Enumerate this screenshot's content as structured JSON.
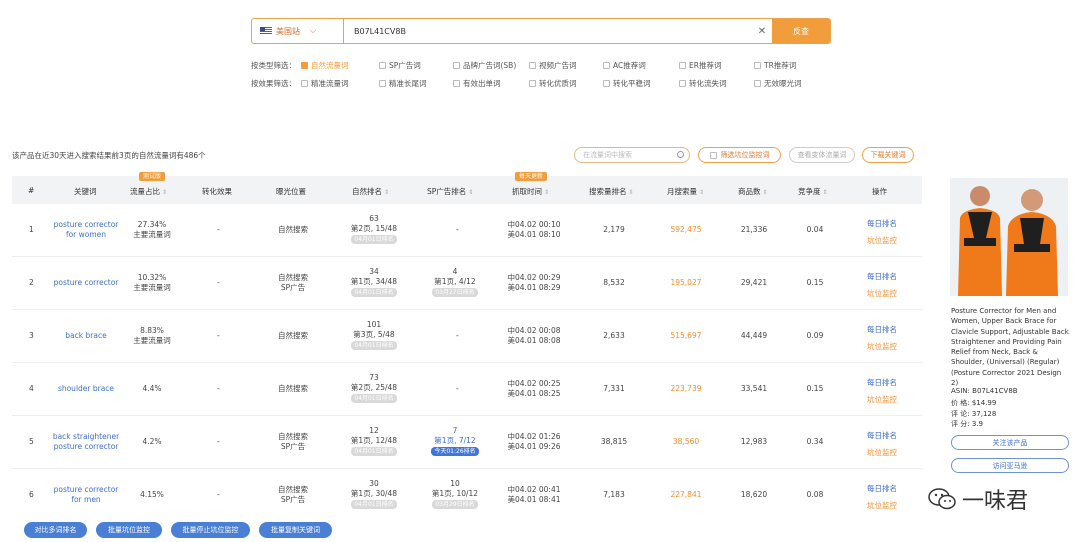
{
  "search": {
    "site": "美国站",
    "query": "B07L41CV8B",
    "button": "反查"
  },
  "filters": {
    "type_label": "按类型筛选：",
    "type_options": [
      {
        "label": "自然流量词",
        "checked": true
      },
      {
        "label": "SP广告词",
        "checked": false
      },
      {
        "label": "品牌广告词(SB)",
        "checked": false
      },
      {
        "label": "视频广告词",
        "checked": false
      },
      {
        "label": "AC推荐词",
        "checked": false
      },
      {
        "label": "ER推荐词",
        "checked": false
      },
      {
        "label": "TR推荐词",
        "checked": false
      }
    ],
    "effect_label": "按效果筛选：",
    "effect_options": [
      {
        "label": "精准流量词",
        "checked": false
      },
      {
        "label": "精准长尾词",
        "checked": false
      },
      {
        "label": "有效出单词",
        "checked": false
      },
      {
        "label": "转化优质词",
        "checked": false
      },
      {
        "label": "转化平稳词",
        "checked": false
      },
      {
        "label": "转化流失词",
        "checked": false
      },
      {
        "label": "无效曝光词",
        "checked": false
      }
    ]
  },
  "summary": "该产品在近30天进入搜索结果前3页的自然流量词有486个",
  "tools": {
    "search_placeholder": "在流量词中搜索",
    "filter_monitor": "筛选坑位监控词",
    "variant_traffic": "查看变体流量词",
    "download": "下载关键词"
  },
  "table": {
    "headers": {
      "index": "#",
      "keyword": "关键词",
      "share": "流量占比",
      "share_tag": "测试版",
      "conversion": "转化效果",
      "exposure": "曝光位置",
      "natural_rank": "自然排名",
      "sp_rank": "SP广告排名",
      "crawl_time": "抓取时间",
      "crawl_tag": "每天更新",
      "search_rank": "搜索量排名",
      "monthly": "月搜索量",
      "products": "商品数",
      "competition": "竞争度",
      "action": "操作"
    },
    "rows": [
      {
        "idx": "1",
        "kw1": "posture corrector",
        "kw2": "for women",
        "share": "27.34%",
        "share_sub": "主要流量词",
        "conv": "-",
        "exp1": "自然搜索",
        "exp2": "",
        "nr_num": "63",
        "nr_page": "第2页, 15/48",
        "nr_date": "04月01日排名",
        "sp_num": "",
        "sp_page": "",
        "sp_date": "",
        "sp_dash": "-",
        "sp_today": false,
        "t_cn": "中04.02 00:10",
        "t_us": "美04.01 08:10",
        "srank": "2,179",
        "monthly": "592,475",
        "products": "21,336",
        "comp": "0.04",
        "a1": "每日排名",
        "a2": "坑位监控"
      },
      {
        "idx": "2",
        "kw1": "posture corrector",
        "kw2": "",
        "share": "10.32%",
        "share_sub": "主要流量词",
        "conv": "-",
        "exp1": "自然搜索",
        "exp2": "SP广告",
        "nr_num": "34",
        "nr_page": "第1页, 34/48",
        "nr_date": "04月01日排名",
        "sp_num": "4",
        "sp_page": "第1页, 4/12",
        "sp_date": "03月27日排名",
        "sp_dash": "",
        "sp_today": false,
        "t_cn": "中04.02 00:29",
        "t_us": "美04.01 08:29",
        "srank": "8,532",
        "monthly": "195,027",
        "products": "29,421",
        "comp": "0.15",
        "a1": "每日排名",
        "a2": "坑位监控"
      },
      {
        "idx": "3",
        "kw1": "back brace",
        "kw2": "",
        "share": "8.83%",
        "share_sub": "主要流量词",
        "conv": "-",
        "exp1": "自然搜索",
        "exp2": "",
        "nr_num": "101",
        "nr_page": "第3页, 5/48",
        "nr_date": "04月01日排名",
        "sp_num": "",
        "sp_page": "",
        "sp_date": "",
        "sp_dash": "-",
        "sp_today": false,
        "t_cn": "中04.02 00:08",
        "t_us": "美04.01 08:08",
        "srank": "2,633",
        "monthly": "515,697",
        "products": "44,449",
        "comp": "0.09",
        "a1": "每日排名",
        "a2": "坑位监控"
      },
      {
        "idx": "4",
        "kw1": "shoulder brace",
        "kw2": "",
        "share": "4.4%",
        "share_sub": "",
        "conv": "-",
        "exp1": "自然搜索",
        "exp2": "",
        "nr_num": "73",
        "nr_page": "第2页, 25/48",
        "nr_date": "04月01日排名",
        "sp_num": "",
        "sp_page": "",
        "sp_date": "",
        "sp_dash": "-",
        "sp_today": false,
        "t_cn": "中04.02 00:25",
        "t_us": "美04.01 08:25",
        "srank": "7,331",
        "monthly": "223,739",
        "products": "33,541",
        "comp": "0.15",
        "a1": "每日排名",
        "a2": "坑位监控"
      },
      {
        "idx": "5",
        "kw1": "back straightener",
        "kw2": "posture corrector",
        "share": "4.2%",
        "share_sub": "",
        "conv": "-",
        "exp1": "自然搜索",
        "exp2": "SP广告",
        "nr_num": "12",
        "nr_page": "第1页, 12/48",
        "nr_date": "04月01日排名",
        "sp_num": "7",
        "sp_page": "第1页, 7/12",
        "sp_date": "今天01:26排名",
        "sp_dash": "",
        "sp_today": true,
        "t_cn": "中04.02 01:26",
        "t_us": "美04.01 09:26",
        "srank": "38,815",
        "monthly": "38,560",
        "products": "12,983",
        "comp": "0.34",
        "a1": "每日排名",
        "a2": "坑位监控"
      },
      {
        "idx": "6",
        "kw1": "posture corrector",
        "kw2": "for men",
        "share": "4.15%",
        "share_sub": "",
        "conv": "-",
        "exp1": "自然搜索",
        "exp2": "SP广告",
        "nr_num": "30",
        "nr_page": "第1页, 30/48",
        "nr_date": "04月01日排名",
        "sp_num": "10",
        "sp_page": "第1页, 10/12",
        "sp_date": "03月29日排名",
        "sp_dash": "",
        "sp_today": false,
        "t_cn": "中04.02 00:41",
        "t_us": "美04.01 08:41",
        "srank": "7,183",
        "monthly": "227,841",
        "products": "18,620",
        "comp": "0.08",
        "a1": "每日排名",
        "a2": "坑位监控"
      }
    ]
  },
  "bottom_buttons": [
    "对比多词排名",
    "批量坑位监控",
    "批量停止坑位监控",
    "批量复制关键词"
  ],
  "product": {
    "title": "Posture Corrector for Men and Women, Upper Back Brace for Clavicle Support, Adjustable Back Straightener and Providing Pain Relief from Neck, Back & Shoulder, (Universal) (Regular) (Posture Corrector 2021 Design 2)",
    "asin_label": "ASIN:",
    "asin": "B07L41CV8B",
    "price_label": "价 格:",
    "price": "$14.99",
    "reviews_label": "评 论:",
    "reviews": "37,128",
    "rating_label": "评 分:",
    "rating": "3.9",
    "follow_btn": "关注该产品",
    "amazon_btn": "访问亚马逊"
  },
  "watermark": "一味君"
}
